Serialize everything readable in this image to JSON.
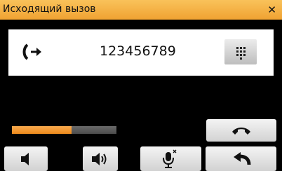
{
  "window": {
    "title": "Исходящий вызов",
    "close_glyph": "✕"
  },
  "call": {
    "number": "123456789",
    "direction_icon": "outgoing-call-icon"
  },
  "progress": {
    "fraction": 0.57
  },
  "buttons": {
    "keypad": "keypad-icon",
    "hangup": "hangup-icon",
    "volume_down": "volume-down-icon",
    "volume_up": "volume-up-icon",
    "mute": "microphone-muted-icon",
    "back": "back-arrow-icon"
  },
  "colors": {
    "accent": "#f0a232",
    "panel": "#ffffff",
    "background": "#000000"
  }
}
